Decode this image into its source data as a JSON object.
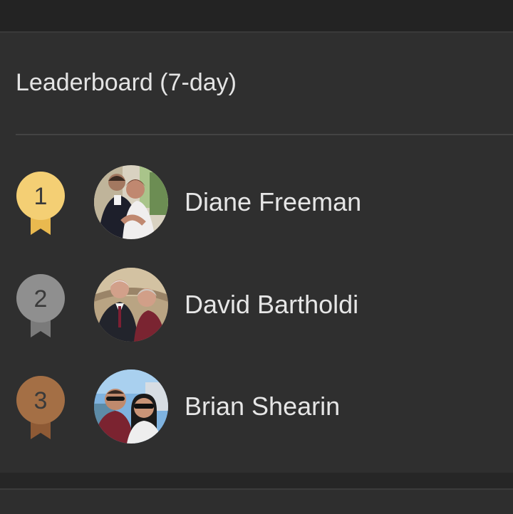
{
  "leaderboard": {
    "title": "Leaderboard (7-day)",
    "entries": [
      {
        "rank": "1",
        "name": "Diane Freeman",
        "medal": "gold-medal",
        "medal_color": "#f4cf74"
      },
      {
        "rank": "2",
        "name": "David Bartholdi",
        "medal": "silver-medal",
        "medal_color": "#8f8f8f"
      },
      {
        "rank": "3",
        "name": "Brian Shearin",
        "medal": "bronze-medal",
        "medal_color": "#a46f45"
      }
    ]
  }
}
